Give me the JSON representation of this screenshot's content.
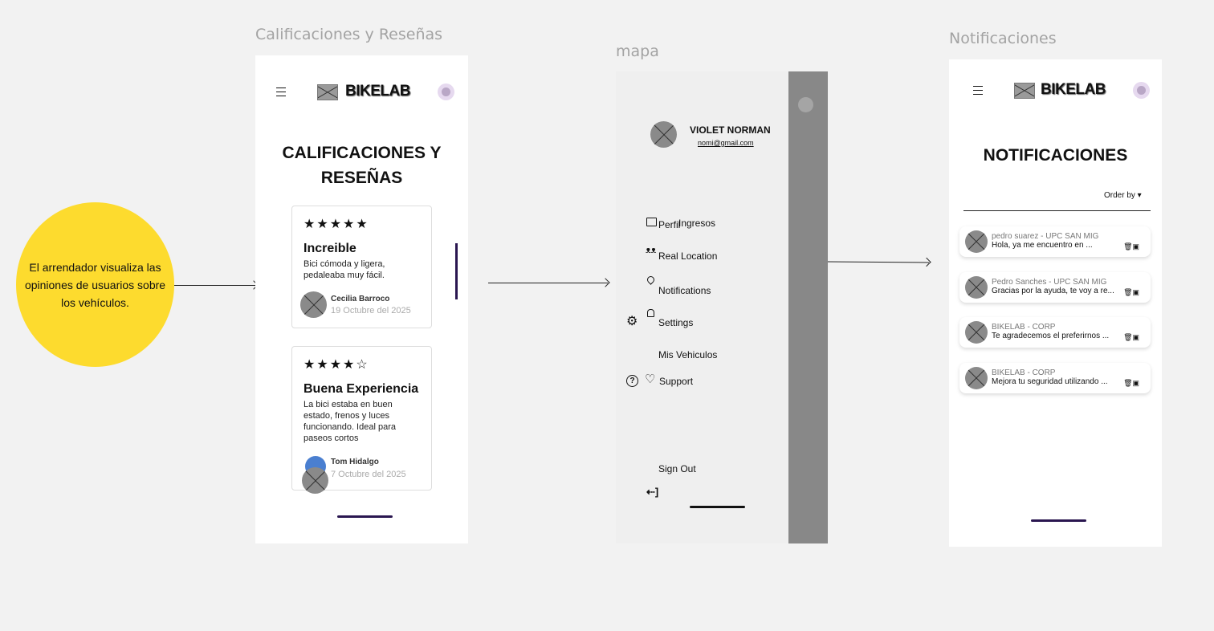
{
  "frames": {
    "reviews": {
      "label": "Calificaciones y Reseñas"
    },
    "map": {
      "label": "mapa"
    },
    "notifications": {
      "label": "Notificaciones"
    }
  },
  "sticky_note": {
    "text": "El arrendador visualiza las opiniones de usuarios sobre los vehículos."
  },
  "header": {
    "brand": "BIKELAB"
  },
  "reviews": {
    "title_line1": "CALIFICACIONES Y",
    "title_line2": "RESEÑAS",
    "items": [
      {
        "stars": "★★★★★",
        "rating": 5,
        "title": "Increible",
        "body": "Bici cómoda y ligera, pedaleaba muy fácil.",
        "author": "Cecilia Barroco",
        "date": "19 Octubre del 2025"
      },
      {
        "stars": "★★★★☆",
        "rating": 4,
        "title": "Buena Experiencia",
        "body": "La bici estaba en buen estado, frenos y luces funcionando. Ideal para paseos cortos",
        "author": "Tom Hidalgo",
        "date": "7 Octubre del 2025"
      }
    ]
  },
  "drawer": {
    "user_name": "VIOLET NORMAN",
    "user_email": "nomi@gmail.com",
    "items": {
      "perfil": "Perfil",
      "ingresos": "Ingresos",
      "real_location": "Real Location",
      "notifications": "Notifications",
      "settings": "Settings",
      "mis_vehiculos": "Mis Vehiculos",
      "support": "Support",
      "sign_out": "Sign Out"
    },
    "icons": {
      "card": "▭",
      "group": "👥",
      "pin": "⌾",
      "bell": "🔔",
      "gear": "⚙",
      "help": "?",
      "heart": "♡",
      "logout": "⇠"
    }
  },
  "notifications": {
    "title": "NOTIFICACIONES",
    "order_by": "Order by ▾",
    "items": [
      {
        "from": "pedro suarez - UPC SAN MIG",
        "message": "Hola, ya me encuentro en ..."
      },
      {
        "from": "Pedro Sanches - UPC SAN MIG",
        "message": "Gracias por la ayuda, te voy a re..."
      },
      {
        "from": "BIKELAB - CORP",
        "message": "Te agradecemos el preferirnos ..."
      },
      {
        "from": "BIKELAB - CORP",
        "message": "Mejora tu seguridad utilizando ..."
      }
    ],
    "actions_glyph": "🗑▣"
  }
}
